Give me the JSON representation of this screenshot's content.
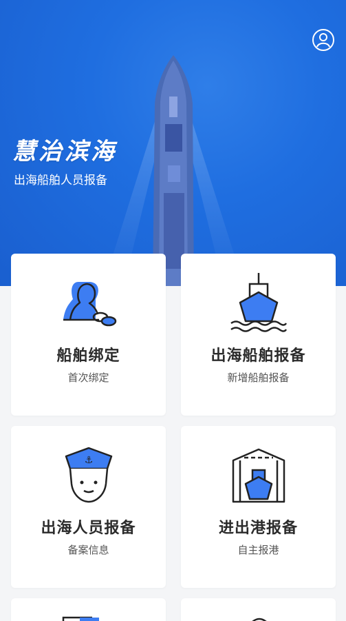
{
  "hero": {
    "title": "慧治滨海",
    "subtitle": "出海船舶人员报备"
  },
  "colors": {
    "primary": "#1f6ee0",
    "accent": "#3d7df2"
  },
  "cards": [
    {
      "title": "船舶绑定",
      "sub": "首次绑定",
      "icon": "person-link-icon"
    },
    {
      "title": "出海船舶报备",
      "sub": "新增船舶报备",
      "icon": "ship-icon"
    },
    {
      "title": "出海人员报备",
      "sub": "备案信息",
      "icon": "sailor-icon"
    },
    {
      "title": "进出港报备",
      "sub": "自主报港",
      "icon": "harbor-icon"
    }
  ]
}
